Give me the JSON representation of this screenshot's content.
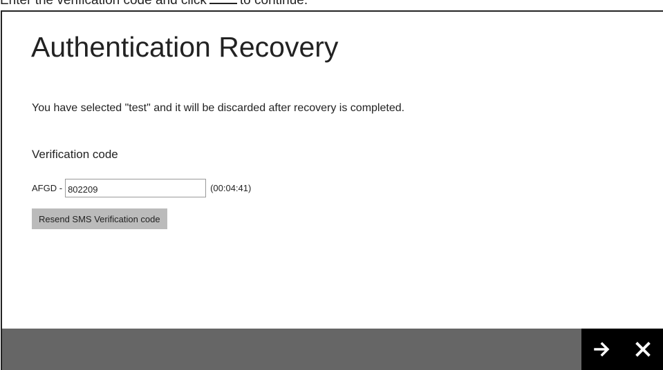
{
  "instruction": {
    "before": "Enter the verification code and click",
    "after": "to continue."
  },
  "dialog": {
    "title": "Authentication Recovery",
    "message": "You have selected \"test\" and it will be discarded after recovery is completed.",
    "verification_label": "Verification code",
    "code_prefix": "AFGD -",
    "code_value": "802209",
    "countdown": "(00:04:41)",
    "resend_label": "Resend SMS Verification code"
  },
  "footer": {
    "next_icon": "arrow-right-icon",
    "close_icon": "close-icon"
  },
  "colors": {
    "footer_bg": "#666666",
    "nav_bg": "#000000",
    "button_bg": "#bbbbbb"
  }
}
